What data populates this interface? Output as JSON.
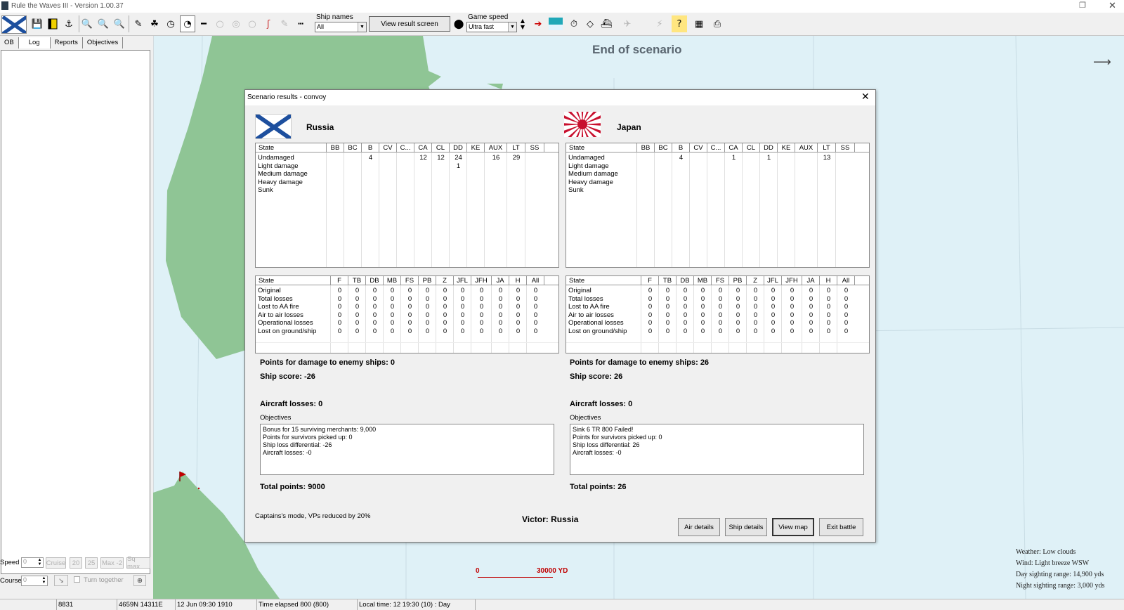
{
  "window": {
    "title": "Rule the Waves III - Version 1.00.37",
    "restore_glyph": "❐",
    "close_glyph": "✕"
  },
  "toolbar": {
    "ship_names_label": "Ship names",
    "ship_names_value": "All",
    "view_result_label": "View result screen",
    "game_speed_label": "Game speed",
    "game_speed_value": "Ultra fast",
    "help_glyph": "?"
  },
  "left_panel": {
    "tabs": [
      "OB",
      "Log",
      "Reports",
      "Objectives"
    ],
    "speed_label": "Speed",
    "speed_value": "0",
    "speed_buttons": [
      "Cruise",
      "20",
      "25",
      "Max -2",
      "Sq max"
    ],
    "course_label": "Course",
    "course_value": "0",
    "turn_together_label": "Turn together"
  },
  "map": {
    "status": "End of scenario",
    "weather": "Weather: Low clouds",
    "wind": "Wind: Light breeze  WSW",
    "day_sighting": "Day sighting range: 14,900 yds",
    "night_sighting": "Night sighting range: 3,000 yds",
    "scale_start": "0",
    "scale_end": "30000 YD",
    "colors": {
      "sea": "#dff1f7",
      "land": "#8fc595",
      "scale": "#c00000"
    }
  },
  "statusbar": [
    "8831",
    "4659N 14311E",
    "12 Jun 09:30 1910",
    "Time elapsed 800 (800)",
    "Local time: 12 19:30 (10) : Day"
  ],
  "dialog": {
    "title": "Scenario results - convoy",
    "ship_columns": [
      "State",
      "BB",
      "BC",
      "B",
      "CV",
      "C...",
      "CA",
      "CL",
      "DD",
      "KE",
      "AUX",
      "LT",
      "SS"
    ],
    "air_columns": [
      "State",
      "F",
      "TB",
      "DB",
      "MB",
      "FS",
      "PB",
      "Z",
      "JFL",
      "JFH",
      "JA",
      "H",
      "All"
    ],
    "left": {
      "nation": "Russia",
      "ship_rows": [
        [
          "Undamaged",
          "",
          "",
          "4",
          "",
          "",
          "12",
          "12",
          "24",
          "",
          "16",
          "29",
          ""
        ],
        [
          "Light damage",
          "",
          "",
          "",
          "",
          "",
          "",
          "",
          "1",
          "",
          "",
          "",
          ""
        ],
        [
          "Medium damage",
          "",
          "",
          "",
          "",
          "",
          "",
          "",
          "",
          "",
          "",
          "",
          ""
        ],
        [
          "Heavy damage",
          "",
          "",
          "",
          "",
          "",
          "",
          "",
          "",
          "",
          "",
          "",
          ""
        ],
        [
          "Sunk",
          "",
          "",
          "",
          "",
          "",
          "",
          "",
          "",
          "",
          "",
          "",
          ""
        ]
      ],
      "air_rows": [
        [
          "Original",
          "0",
          "0",
          "0",
          "0",
          "0",
          "0",
          "0",
          "0",
          "0",
          "0",
          "0",
          "0"
        ],
        [
          "Total losses",
          "0",
          "0",
          "0",
          "0",
          "0",
          "0",
          "0",
          "0",
          "0",
          "0",
          "0",
          "0"
        ],
        [
          "Lost to AA fire",
          "0",
          "0",
          "0",
          "0",
          "0",
          "0",
          "0",
          "0",
          "0",
          "0",
          "0",
          "0"
        ],
        [
          "Air to air losses",
          "0",
          "0",
          "0",
          "0",
          "0",
          "0",
          "0",
          "0",
          "0",
          "0",
          "0",
          "0"
        ],
        [
          "Operational losses",
          "0",
          "0",
          "0",
          "0",
          "0",
          "0",
          "0",
          "0",
          "0",
          "0",
          "0",
          "0"
        ],
        [
          "Lost on ground/ship",
          "0",
          "0",
          "0",
          "0",
          "0",
          "0",
          "0",
          "0",
          "0",
          "0",
          "0",
          "0"
        ]
      ],
      "points_damage": "Points for damage to enemy ships: 0",
      "ship_score": "Ship score: -26",
      "aircraft_losses": "Aircraft losses: 0",
      "objectives_label": "Objectives",
      "objectives": [
        "Bonus for 15 surviving merchants: 9,000",
        "Points for survivors picked up: 0",
        "Ship loss differential: -26",
        "Aircraft losses: -0"
      ],
      "total_points": "Total points: 9000"
    },
    "right": {
      "nation": "Japan",
      "ship_rows": [
        [
          "Undamaged",
          "",
          "",
          "4",
          "",
          "",
          "1",
          "",
          "1",
          "",
          "",
          "13",
          ""
        ],
        [
          "Light damage",
          "",
          "",
          "",
          "",
          "",
          "",
          "",
          "",
          "",
          "",
          "",
          ""
        ],
        [
          "Medium damage",
          "",
          "",
          "",
          "",
          "",
          "",
          "",
          "",
          "",
          "",
          "",
          ""
        ],
        [
          "Heavy damage",
          "",
          "",
          "",
          "",
          "",
          "",
          "",
          "",
          "",
          "",
          "",
          ""
        ],
        [
          "Sunk",
          "",
          "",
          "",
          "",
          "",
          "",
          "",
          "",
          "",
          "",
          "",
          ""
        ]
      ],
      "air_rows": [
        [
          "Original",
          "0",
          "0",
          "0",
          "0",
          "0",
          "0",
          "0",
          "0",
          "0",
          "0",
          "0",
          "0"
        ],
        [
          "Total losses",
          "0",
          "0",
          "0",
          "0",
          "0",
          "0",
          "0",
          "0",
          "0",
          "0",
          "0",
          "0"
        ],
        [
          "Lost to AA fire",
          "0",
          "0",
          "0",
          "0",
          "0",
          "0",
          "0",
          "0",
          "0",
          "0",
          "0",
          "0"
        ],
        [
          "Air to air losses",
          "0",
          "0",
          "0",
          "0",
          "0",
          "0",
          "0",
          "0",
          "0",
          "0",
          "0",
          "0"
        ],
        [
          "Operational losses",
          "0",
          "0",
          "0",
          "0",
          "0",
          "0",
          "0",
          "0",
          "0",
          "0",
          "0",
          "0"
        ],
        [
          "Lost on ground/ship",
          "0",
          "0",
          "0",
          "0",
          "0",
          "0",
          "0",
          "0",
          "0",
          "0",
          "0",
          "0"
        ]
      ],
      "points_damage": "Points for damage to enemy ships: 26",
      "ship_score": "Ship score: 26",
      "aircraft_losses": "Aircraft losses: 0",
      "objectives_label": "Objectives",
      "objectives": [
        "Sink 6 TR   800   Failed!",
        "Points for survivors picked up: 0",
        "Ship loss differential: 26",
        "Aircraft losses: -0"
      ],
      "total_points": "Total points: 26"
    },
    "captains_note": "Captains's mode, VPs reduced by 20%",
    "victor": "Victor: Russia",
    "buttons": {
      "air_details": "Air details",
      "ship_details": "Ship details",
      "view_map": "View map",
      "exit_battle": "Exit battle"
    }
  }
}
